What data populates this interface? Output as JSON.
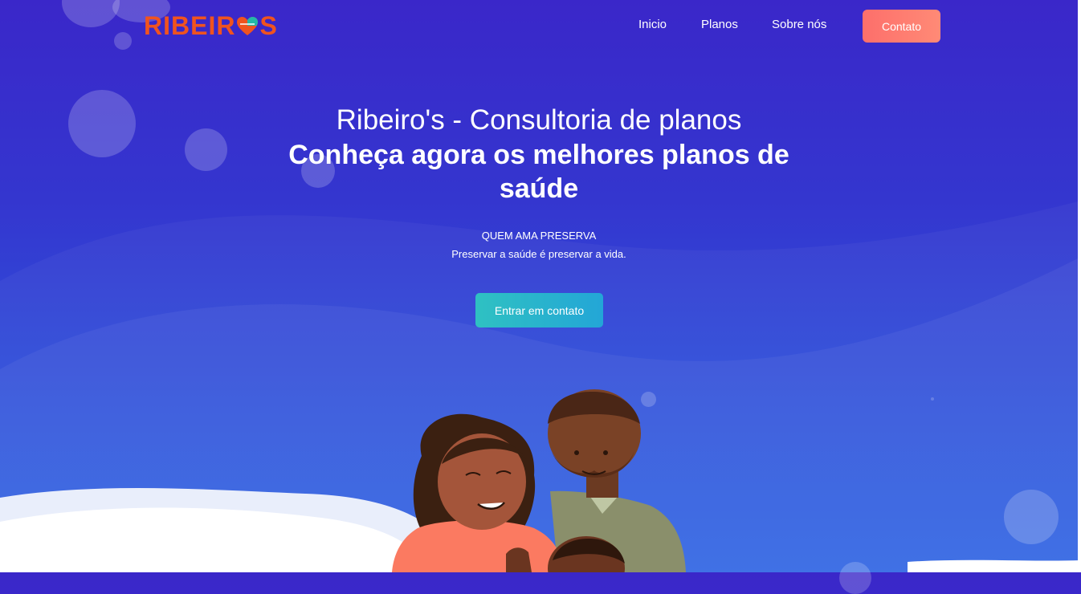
{
  "brand": {
    "logo_text_left": "RIBEIR",
    "logo_text_right": "S",
    "color": "#f0531f"
  },
  "nav": {
    "items": [
      {
        "label": "Inicio"
      },
      {
        "label": "Planos"
      },
      {
        "label": "Sobre nós"
      }
    ],
    "contact_button": "Contato"
  },
  "hero": {
    "line1": "Ribeiro's - Consultoria de planos",
    "line2": "Conheça agora os melhores planos de saúde",
    "tagline_title": "QUEM AMA PRESERVA",
    "tagline_sub": "Preservar a saúde é preservar a vida.",
    "cta_label": "Entrar em contato"
  },
  "colors": {
    "background_top": "#3a27c9",
    "background_bottom": "#2e64e3",
    "contact_button": "#fd6f6b",
    "cta_button": "#2fc1c2"
  }
}
